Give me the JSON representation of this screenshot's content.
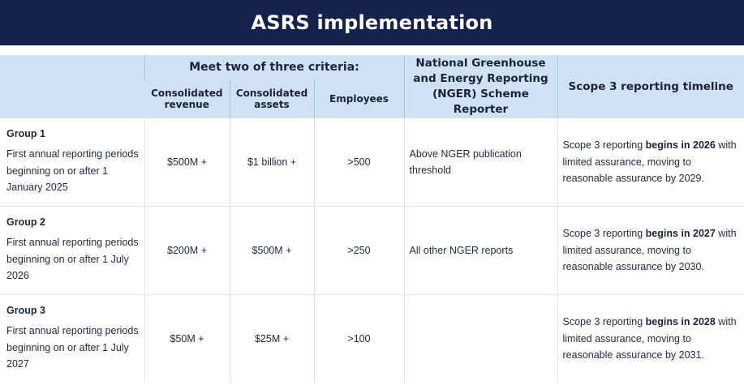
{
  "title": "ASRS implementation",
  "header": {
    "criteria_label": "Meet two of three criteria:",
    "col_revenue": "Consolidated revenue",
    "col_assets": "Consolidated assets",
    "col_employees": "Employees",
    "col_nger": "National Greenhouse and Energy Reporting (NGER) Scheme Reporter",
    "col_scope3": "Scope 3 reporting timeline"
  },
  "rows": [
    {
      "group": "Group 1",
      "description": "First annual reporting periods beginning on or after 1 January 2025",
      "revenue": "$500M +",
      "assets": "$1 billion +",
      "employees": ">500",
      "nger": "Above NGER publication threshold",
      "scope3_pre": "Scope 3 reporting ",
      "scope3_bold": "begins in 2026",
      "scope3_post": " with limited assurance, moving to reasonable assurance by 2029."
    },
    {
      "group": "Group 2",
      "description": "First annual reporting periods beginning on or after 1 July 2026",
      "revenue": "$200M +",
      "assets": "$500M +",
      "employees": ">250",
      "nger": "All other NGER reports",
      "scope3_pre": "Scope 3 reporting ",
      "scope3_bold": "begins in 2027",
      "scope3_post": " with limited assurance, moving to reasonable assurance by 2030."
    },
    {
      "group": "Group 3",
      "description": "First annual reporting periods beginning on or after 1 July 2027",
      "revenue": "$50M +",
      "assets": "$25M +",
      "employees": ">100",
      "nger": "",
      "scope3_pre": "Scope 3 reporting ",
      "scope3_bold": "begins in 2028",
      "scope3_post": " with limited assurance, moving to reasonable assurance by 2031."
    }
  ],
  "colors": {
    "banner": "#15234a",
    "header_bg": "#cfe2f3",
    "grid": "#dbe6f0"
  }
}
